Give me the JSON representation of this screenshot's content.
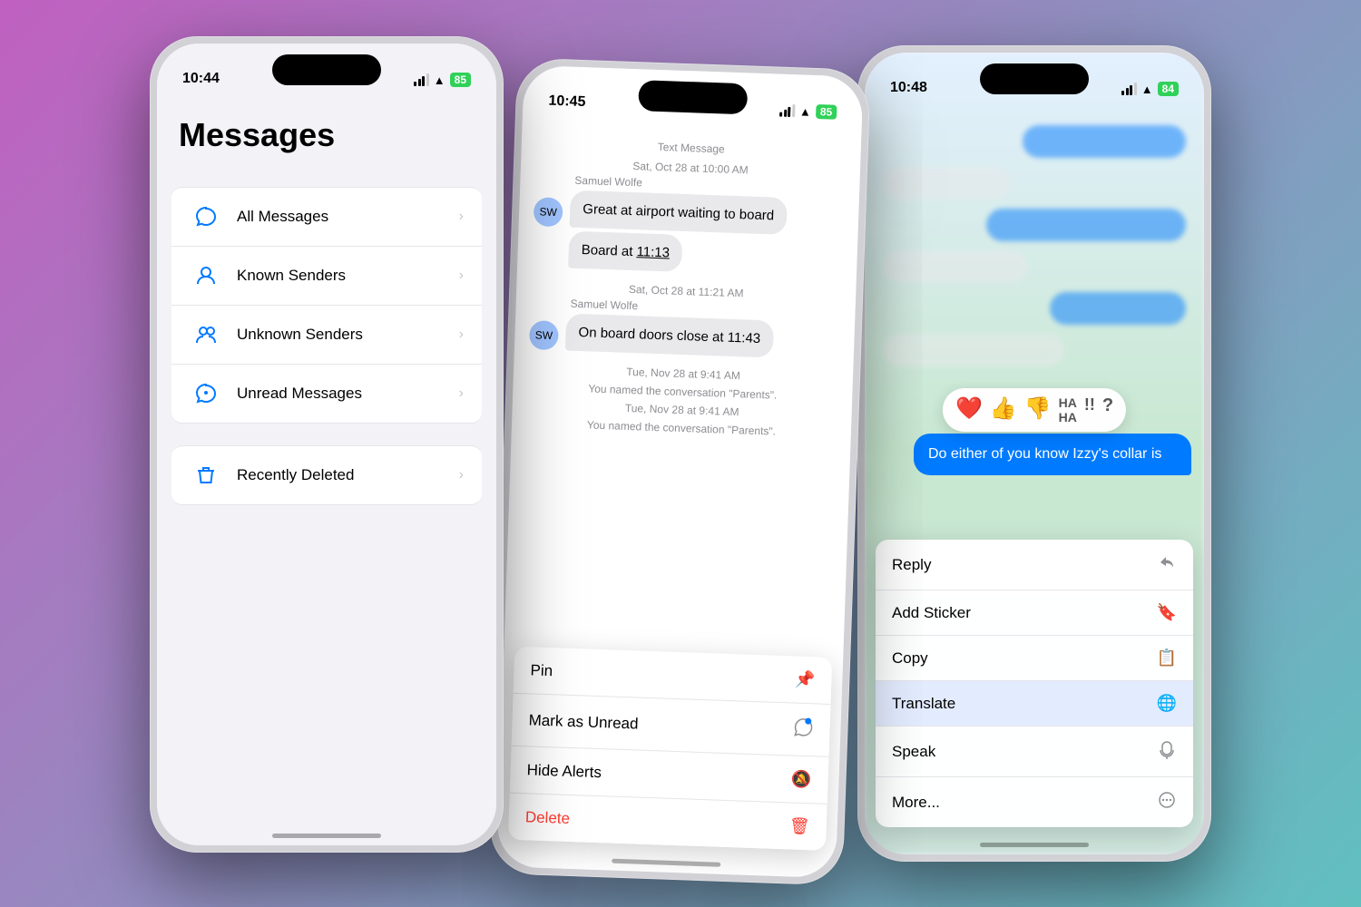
{
  "phone1": {
    "time": "10:44",
    "title": "Messages",
    "items": [
      {
        "label": "All Messages",
        "icon": "💬"
      },
      {
        "label": "Known Senders",
        "icon": "👤"
      },
      {
        "label": "Unknown Senders",
        "icon": "👥"
      },
      {
        "label": "Unread Messages",
        "icon": "💬"
      }
    ],
    "deleted": {
      "label": "Recently Deleted",
      "icon": "🗑"
    }
  },
  "phone2": {
    "time": "10:45",
    "contact": "Samuel Wolfe",
    "messages": [
      {
        "type": "timestamp",
        "text": "Text Message"
      },
      {
        "type": "timestamp2",
        "text": "Sat, Oct 28 at 10:00 AM"
      },
      {
        "type": "sender",
        "text": "Samuel Wolfe"
      },
      {
        "type": "received",
        "text": "Great at airport waiting to board"
      },
      {
        "type": "received2",
        "text": "Board at 11:13"
      },
      {
        "type": "timestamp3",
        "text": "Sat, Oct 28 at 11:21 AM"
      },
      {
        "type": "sender2",
        "text": "Samuel Wolfe"
      },
      {
        "type": "received3",
        "text": "On board doors close at 11:43"
      },
      {
        "type": "system",
        "text": "Tue, Nov 28 at 9:41 AM"
      },
      {
        "type": "system2",
        "text": "You named the conversation \"Parents\"."
      },
      {
        "type": "system3",
        "text": "Tue, Nov 28 at 9:41 AM"
      },
      {
        "type": "system4",
        "text": "You named the conversation \"Parents\"."
      }
    ],
    "menu": [
      {
        "label": "Pin",
        "icon": "📌"
      },
      {
        "label": "Mark as Unread",
        "icon": "💬"
      },
      {
        "label": "Hide Alerts",
        "icon": "🔕"
      },
      {
        "label": "Delete",
        "icon": "🗑",
        "type": "delete"
      }
    ]
  },
  "phone3": {
    "time": "10:48",
    "active_message": "Do either of you know Izzy's collar is",
    "menu": [
      {
        "label": "Reply",
        "icon": "↩"
      },
      {
        "label": "Add Sticker",
        "icon": "🔖"
      },
      {
        "label": "Copy",
        "icon": "📋"
      },
      {
        "label": "Translate",
        "icon": "🌐",
        "highlighted": true
      },
      {
        "label": "Speak",
        "icon": "💬"
      },
      {
        "label": "More...",
        "icon": "⊙"
      }
    ],
    "tapbacks": [
      "❤️",
      "👍",
      "👎",
      "HA",
      "!!",
      "?"
    ]
  }
}
